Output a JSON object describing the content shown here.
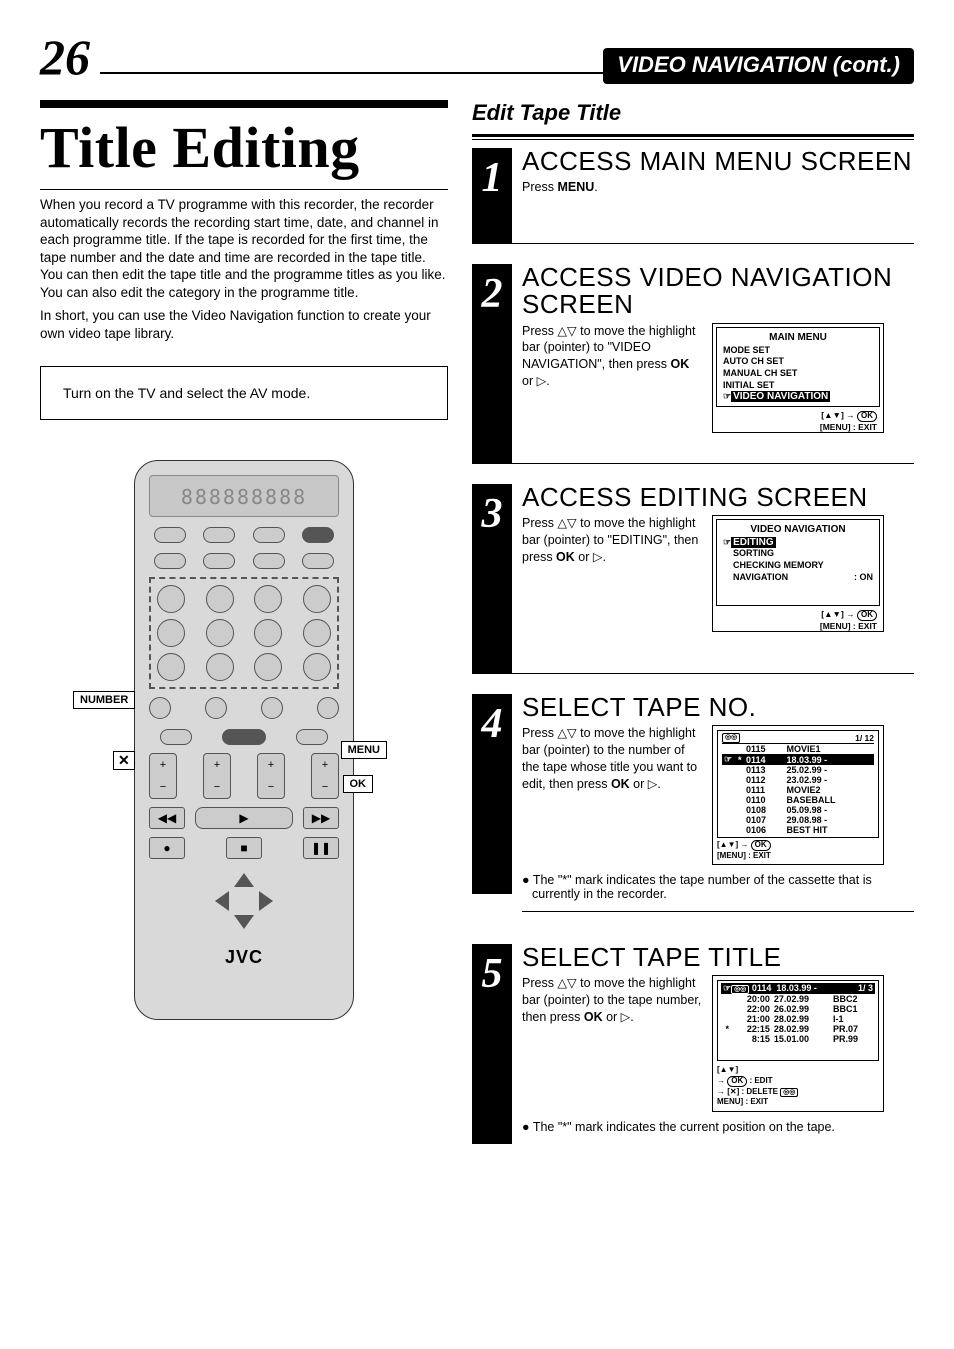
{
  "header": {
    "page_number": "26",
    "section_title": "VIDEO NAVIGATION (cont.)"
  },
  "left": {
    "main_title": "Title Editing",
    "intro": "When you record a TV programme with this recorder, the recorder automatically records the recording start time, date, and channel in each programme title. If the tape is recorded for the first time, the tape number and the date and time are recorded in the tape title. You can then edit the tape title and the programme titles as you like. You can also edit the category in the programme title.",
    "intro2": "In short, you can use the Video Navigation function to create your own video tape library.",
    "note_box": "Turn on the TV and select the AV mode.",
    "remote": {
      "lcd": "888888888",
      "brand": "JVC",
      "callouts": {
        "number": "NUMBER",
        "x": "✕",
        "menu": "MENU",
        "ok": "OK"
      }
    }
  },
  "right": {
    "heading": "Edit Tape Title",
    "step1": {
      "title": "ACCESS MAIN MENU SCREEN",
      "text_a": "Press ",
      "menu_bold": "MENU",
      "text_b": "."
    },
    "step2": {
      "title": "ACCESS VIDEO NAVIGATION SCREEN",
      "text_a": "Press △▽ to move the highlight bar (pointer) to \"VIDEO NAVIGATION\", then press ",
      "ok_bold": "OK",
      "text_b": " or ▷.",
      "osd": {
        "header": "MAIN MENU",
        "items": [
          "MODE SET",
          "AUTO CH SET",
          "MANUAL CH SET",
          "INITIAL SET"
        ],
        "selected": "VIDEO NAVIGATION",
        "hint_arrows": "[▲▼] → ",
        "hint_ok": "OK",
        "hint_exit": "[MENU] : EXIT"
      }
    },
    "step3": {
      "title": "ACCESS EDITING SCREEN",
      "text_a": "Press △▽ to move the highlight bar (pointer) to \"EDITING\", then press ",
      "ok_bold": "OK",
      "text_b": " or ▷.",
      "osd": {
        "header": "VIDEO NAVIGATION",
        "selected": "EDITING",
        "items": [
          "SORTING",
          "CHECKING MEMORY"
        ],
        "nav_label": "NAVIGATION",
        "nav_value": ": ON",
        "hint_arrows": "[▲▼] → ",
        "hint_ok": "OK",
        "hint_exit": "[MENU] : EXIT"
      }
    },
    "step4": {
      "title": "SELECT TAPE NO.",
      "text_a": "Press △▽ to move the highlight bar (pointer) to the number of the tape whose title you want to edit, then press ",
      "ok_bold": "OK",
      "text_b": " or ▷.",
      "list": {
        "counter": "1/ 12",
        "rows": [
          {
            "no": "0115",
            "title": "MOVIE1",
            "sel": false,
            "star": false
          },
          {
            "no": "0114",
            "title": "18.03.99 -",
            "sel": true,
            "star": true
          },
          {
            "no": "0113",
            "title": "25.02.99 -",
            "sel": false,
            "star": false
          },
          {
            "no": "0112",
            "title": "23.02.99 -",
            "sel": false,
            "star": false
          },
          {
            "no": "0111",
            "title": "MOVIE2",
            "sel": false,
            "star": false
          },
          {
            "no": "0110",
            "title": "BASEBALL",
            "sel": false,
            "star": false
          },
          {
            "no": "0108",
            "title": "05.09.98 -",
            "sel": false,
            "star": false
          },
          {
            "no": "0107",
            "title": "29.08.98 -",
            "sel": false,
            "star": false
          },
          {
            "no": "0106",
            "title": "BEST HIT",
            "sel": false,
            "star": false
          }
        ],
        "hint_arrows": "[▲▼] → ",
        "hint_ok": "OK",
        "hint_exit": "[MENU] : EXIT"
      },
      "note": "The \"*\"  mark indicates the tape number of the cassette that is currently in the recorder."
    },
    "step5": {
      "title": "SELECT TAPE TITLE",
      "text_a": "Press △▽ to move the highlight bar (pointer) to the tape number, then press ",
      "ok_bold": "OK",
      "text_b": " or ▷.",
      "list": {
        "tape_no": "0114",
        "tape_date": "18.03.99 -",
        "counter": "1/  3",
        "rows": [
          {
            "time": "20:00",
            "date": "27.02.99",
            "ch": "BBC2",
            "star": false
          },
          {
            "time": "22:00",
            "date": "26.02.99",
            "ch": "BBC1",
            "star": false
          },
          {
            "time": "21:00",
            "date": "28.02.99",
            "ch": "I-1",
            "star": false
          },
          {
            "time": "22:15",
            "date": "28.02.99",
            "ch": "PR.07",
            "star": true
          },
          {
            "time": "8:15",
            "date": "15.01.00",
            "ch": "PR.99",
            "star": false
          }
        ],
        "foot_arrows": "[▲▼]",
        "foot_edit_ok": "OK",
        "foot_edit": " : EDIT",
        "foot_del_x": "[✕]",
        "foot_del": " : DELETE ",
        "foot_exit": "MENU] : EXIT"
      },
      "note": "The \"*\" mark indicates the current position on the tape."
    }
  }
}
